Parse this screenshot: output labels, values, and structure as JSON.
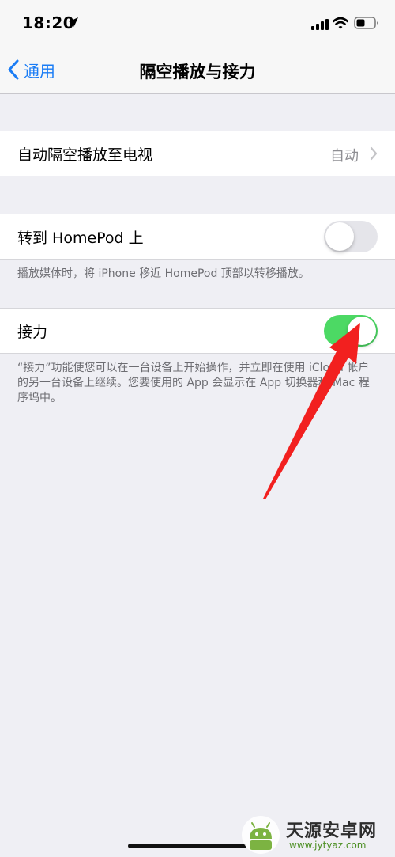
{
  "status_bar": {
    "time": "18:20"
  },
  "nav": {
    "back_label": "通用",
    "title": "隔空播放与接力"
  },
  "airplay_row": {
    "label": "自动隔空播放至电视",
    "value": "自动"
  },
  "homepod_row": {
    "label": "转到 HomePod 上",
    "toggle_state": "off",
    "footnote": "播放媒体时，将 iPhone 移近 HomePod 顶部以转移播放。"
  },
  "handoff_row": {
    "label": "接力",
    "toggle_state": "on",
    "footnote": "“接力”功能使您可以在一台设备上开始操作，并立即在使用 iCloud 帐户的另一台设备上继续。您要使用的 App 会显示在 App 切换器和 Mac 程序坞中。"
  },
  "watermark": {
    "title": "天源安卓网",
    "url": "www.jytyaz.com"
  },
  "colors": {
    "accent": "#1a7cf5",
    "toggle_on": "#4cd964",
    "toggle_off": "#e5e5ea",
    "background": "#efeff4",
    "annotation_arrow": "#f2201f"
  },
  "icons": [
    "location-arrow-icon",
    "cellular-signal-icon",
    "wifi-icon",
    "battery-icon",
    "chevron-left-icon",
    "chevron-right-icon"
  ]
}
